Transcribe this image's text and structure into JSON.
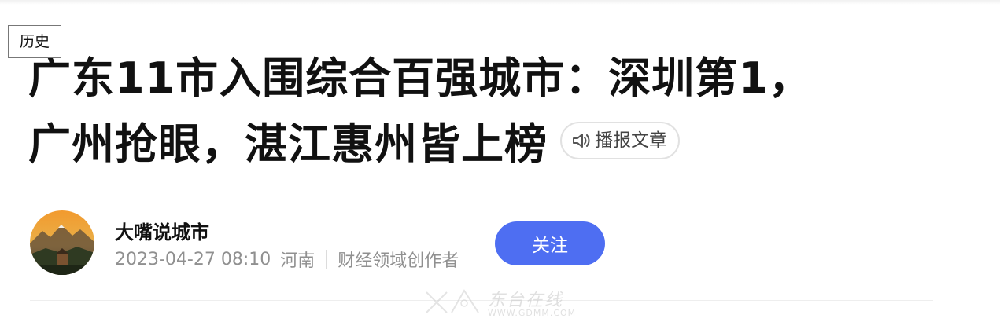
{
  "nav": {
    "history_label": "历史"
  },
  "article": {
    "title_line1": "广东11市入围综合百强城市：深圳第1，",
    "title_line2": "广州抢眼，湛江惠州皆上榜",
    "listen_label": "播报文章",
    "listen_icon": "speaker-icon"
  },
  "author": {
    "name": "大嘴说城市",
    "date": "2023-04-27 08:10",
    "location": "河南",
    "role": "财经领域创作者",
    "follow_label": "关注",
    "avatar_icon": "landscape-avatar"
  },
  "watermark": {
    "text": "东台在线",
    "url": "WWW.GDMM.COM"
  },
  "colors": {
    "follow_bg": "#4e6ef2",
    "title": "#111111",
    "meta": "#909090"
  }
}
